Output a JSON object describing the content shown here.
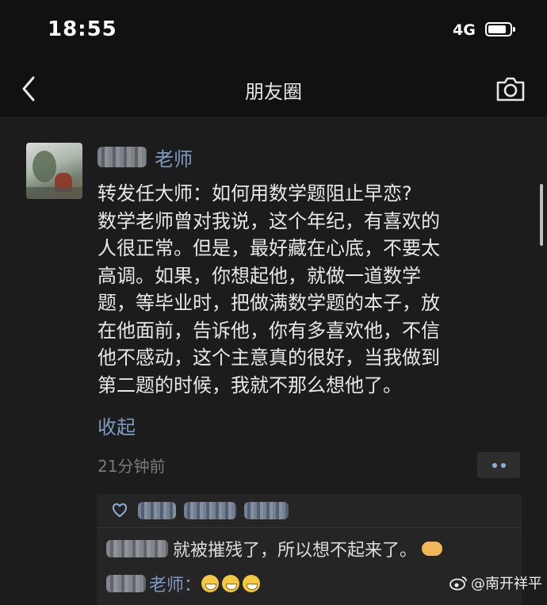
{
  "status_bar": {
    "time": "18:55",
    "network": "4G"
  },
  "nav": {
    "title": "朋友圈"
  },
  "post": {
    "author_suffix": "老师",
    "lines": [
      "转发任大师：如何用数学题阻止早恋?",
      "数学老师曾对我说，这个年纪，有喜欢的",
      "人很正常。但是，最好藏在心底，不要太",
      "高调。如果，你想起他，就做一道数学",
      "题，等毕业时，把做满数学题的本子，放",
      "在他面前，告诉他，你有多喜欢他，不信",
      "他不感动，这个主意真的很好，当我做到",
      "第二题的时候，我就不那么想他了。"
    ],
    "collapse_label": "收起",
    "time_ago": "21分钟前"
  },
  "comments": [
    {
      "name_suffix": "",
      "text": "就被摧残了，所以想不起来了。"
    },
    {
      "name_suffix": "老师",
      "text": ""
    }
  ],
  "watermark": "@南开祥平",
  "colors": {
    "link_blue": "#7f9bc4",
    "background": "#1c1c1c",
    "bar": "#111111"
  }
}
